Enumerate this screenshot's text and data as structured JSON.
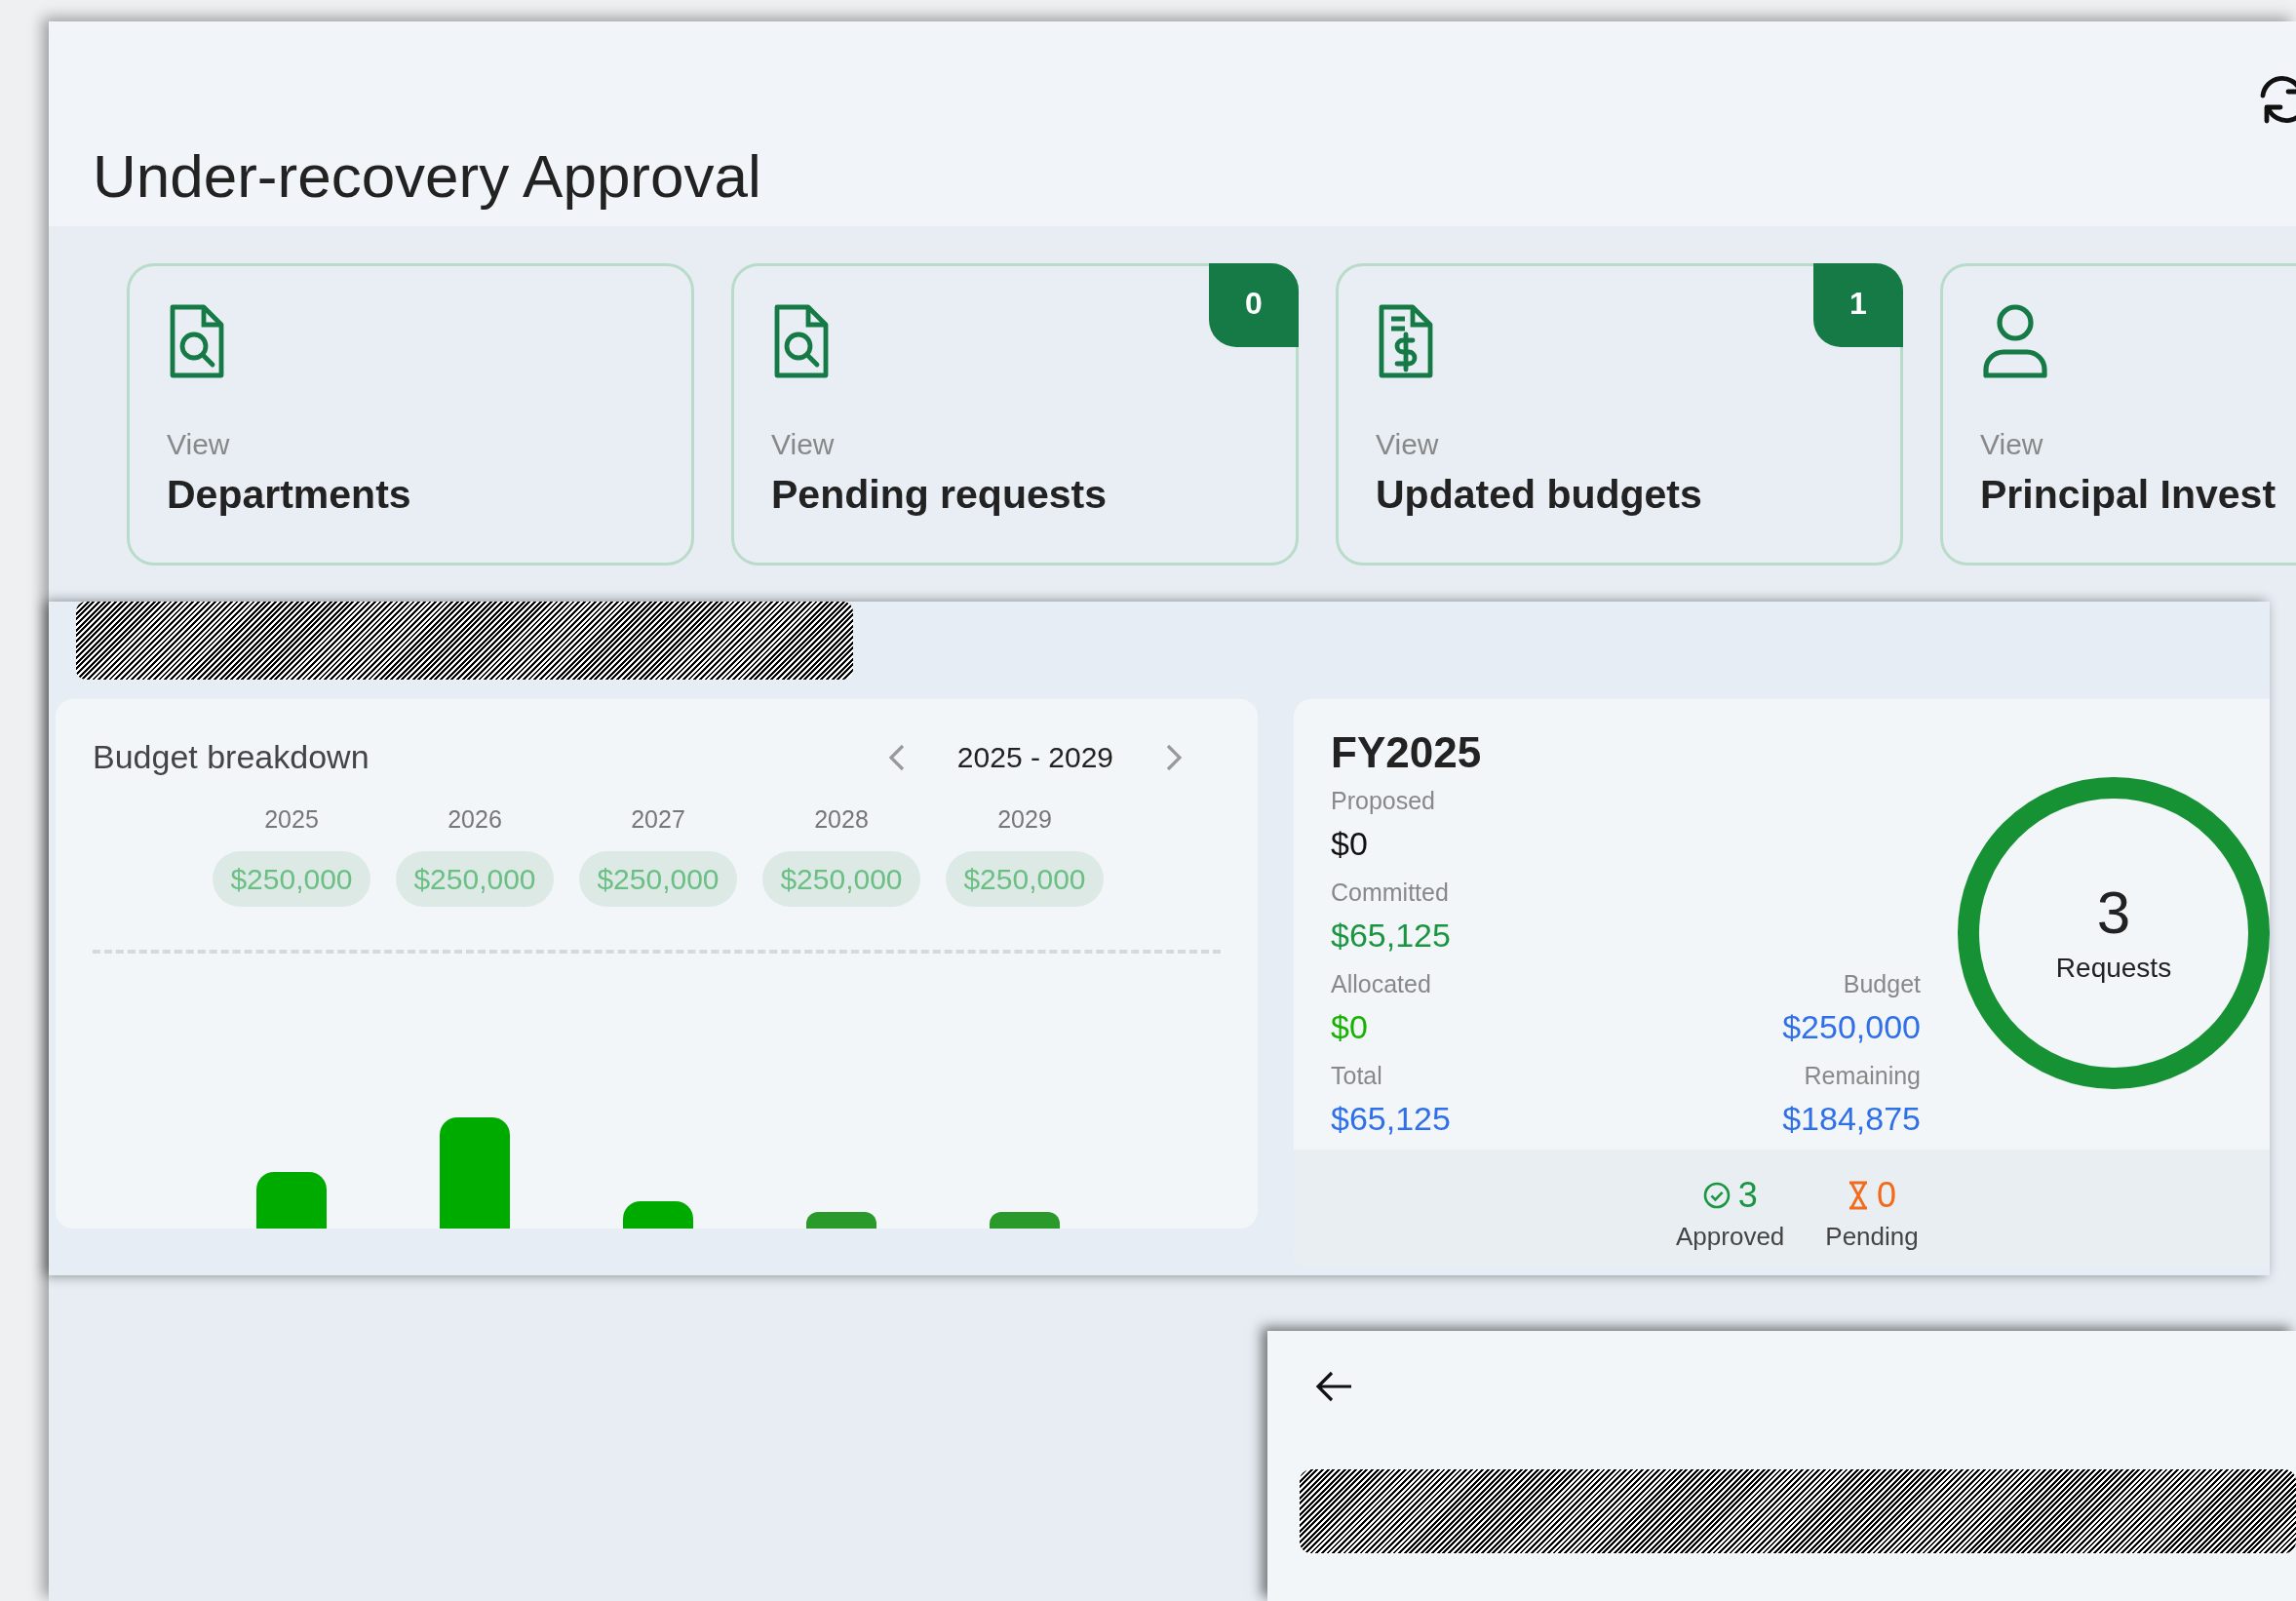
{
  "header": {
    "title": "Under-recovery Approval"
  },
  "nav_cards": [
    {
      "kind": "document-search",
      "caption": "View",
      "label": "Departments"
    },
    {
      "kind": "document-search",
      "caption": "View",
      "label": "Pending requests",
      "badge": "0"
    },
    {
      "kind": "document-dollar",
      "caption": "View",
      "label": "Updated budgets",
      "badge": "1"
    },
    {
      "kind": "person",
      "caption": "View",
      "label": "Principal Invest"
    }
  ],
  "budget_breakdown": {
    "title": "Budget breakdown",
    "range": "2025 - 2029",
    "years": [
      {
        "year": "2025",
        "amount": "$250,000"
      },
      {
        "year": "2026",
        "amount": "$250,000"
      },
      {
        "year": "2027",
        "amount": "$250,000"
      },
      {
        "year": "2028",
        "amount": "$250,000"
      },
      {
        "year": "2029",
        "amount": "$250,000"
      }
    ]
  },
  "fiscal_year": {
    "title": "FY2025",
    "rows": [
      {
        "left": {
          "label": "Proposed",
          "value": "$0",
          "color": "#111111"
        }
      },
      {
        "left": {
          "label": "Committed",
          "value": "$65,125",
          "color": "#1a9641"
        }
      },
      {
        "left": {
          "label": "Allocated",
          "value": "$0",
          "color": "#15b300"
        },
        "right": {
          "label": "Budget",
          "value": "$250,000",
          "color": "#2f6fe8"
        }
      },
      {
        "left": {
          "label": "Total",
          "value": "$65,125",
          "color": "#2f6fe8"
        },
        "right": {
          "label": "Remaining",
          "value": "$184,875",
          "color": "#2f6fe8"
        }
      }
    ],
    "requests": {
      "count": "3",
      "label": "Requests"
    },
    "status": [
      {
        "kind": "approved",
        "count": "3",
        "label": "Approved"
      },
      {
        "kind": "pending",
        "count": "0",
        "label": "Pending"
      }
    ]
  }
}
